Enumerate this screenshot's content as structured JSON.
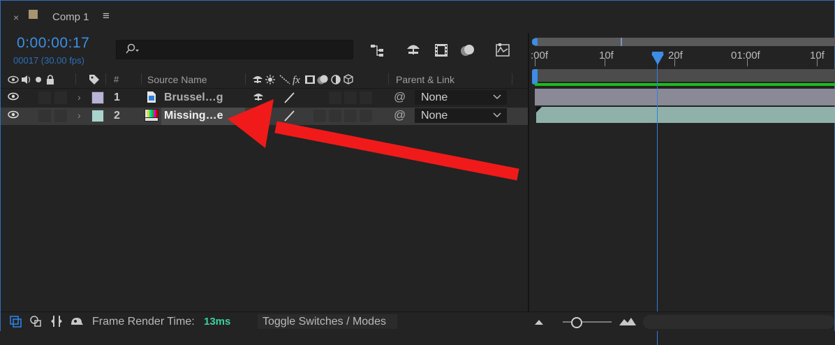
{
  "tab": {
    "close": "×",
    "title": "Comp 1",
    "menu": "≡",
    "swatch_color": "#a89372"
  },
  "timecode": {
    "value": "0:00:00:17",
    "frames": "00017 (30.00 fps)"
  },
  "search": {
    "placeholder": "",
    "icon": "search-icon"
  },
  "header": {
    "source_name": "Source Name",
    "hash": "#",
    "parent_link": "Parent & Link",
    "fx": "fx"
  },
  "layers": [
    {
      "number": "1",
      "name": "Brussel…g",
      "parent": "None",
      "label_color": "#b9b3d6",
      "type": "image"
    },
    {
      "number": "2",
      "name": "Missing…e",
      "parent": "None",
      "label_color": "#a9d4cc",
      "type": "color-bars"
    }
  ],
  "timeline": {
    "ticks": [
      ":00f",
      "10f",
      "20f",
      "01:00f",
      "10f"
    ],
    "layer1_bar_color": "#8a8a96",
    "layer2_bar_color": "#8fb1aa"
  },
  "footer": {
    "frame_render_label": "Frame Render Time:",
    "frame_render_value": "13ms",
    "toggle_label": "Toggle Switches / Modes"
  },
  "colors": {
    "accent": "#3b8fe6",
    "arrow": "#f01a1a",
    "green": "#1dbb1d"
  }
}
